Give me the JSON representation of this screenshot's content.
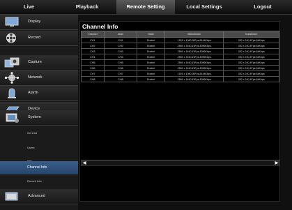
{
  "nav": {
    "tabs": [
      "Live",
      "Playback",
      "Remote Setting",
      "Local Settings",
      "Logout"
    ],
    "active_tab": "Remote Setting"
  },
  "sidebar": {
    "items": [
      {
        "label": "Display",
        "icon": "monitor-icon"
      },
      {
        "label": "Record",
        "icon": "film-reel-icon"
      },
      {
        "label": "Capture",
        "icon": "camera-capture-icon"
      },
      {
        "label": "Network",
        "icon": "network-globe-icon"
      },
      {
        "label": "Alarm",
        "icon": "alarm-icon"
      },
      {
        "label": "Device",
        "icon": "hard-disk-icon"
      },
      {
        "label": "System",
        "icon": "system-icon"
      }
    ],
    "system_sub_items": [
      "General",
      "Users",
      "Info",
      "Channel Info",
      "Record Info"
    ],
    "active_sub_item": "Channel Info",
    "advanced": {
      "label": "Advanced",
      "icon": "advanced-icon"
    }
  },
  "main": {
    "title": "Channel Info",
    "columns": [
      "Channel",
      "Alias",
      "State",
      "Mainstream",
      "Substream"
    ],
    "rows": [
      [
        "CH1",
        "CH1",
        "Enable",
        "1920 x 1080,30Fps,6144Kbps",
        "352 x 240,4Fps,64Kbps"
      ],
      [
        "CH2",
        "CH2",
        "Enable",
        "2560 x 1440,15Fps,4096Kbps",
        "352 x 240,4Fps,64Kbps"
      ],
      [
        "CH3",
        "CH3",
        "Enable",
        "2560 x 1440,15Fps,4096Kbps",
        "352 x 240,4Fps,64Kbps"
      ],
      [
        "CH4",
        "CH4",
        "Enable",
        "2560 x 1440,15Fps,4096Kbps",
        "352 x 240,4Fps,64Kbps"
      ],
      [
        "CH5",
        "CH5",
        "Enable",
        "2560 x 1440,15Fps,4096Kbps",
        "352 x 240,4Fps,64Kbps"
      ],
      [
        "CH6",
        "CH6",
        "Enable",
        "2560 x 1440,15Fps,4096Kbps",
        "352 x 240,4Fps,64Kbps"
      ],
      [
        "CH7",
        "CH7",
        "Enable",
        "1920 x 1080,30Fps,6144Kbps",
        "352 x 240,4Fps,64Kbps"
      ],
      [
        "CH8",
        "CH8",
        "Enable",
        "2560 x 1440,15Fps,4096Kbps",
        "352 x 240,4Fps,64Kbps"
      ]
    ],
    "scroll_left_icon": "chevron-left-icon",
    "scroll_right_icon": "chevron-right-icon"
  },
  "colors": {
    "active_highlight": "#2f5482",
    "background": "#101010",
    "panel_background": "#000000"
  }
}
